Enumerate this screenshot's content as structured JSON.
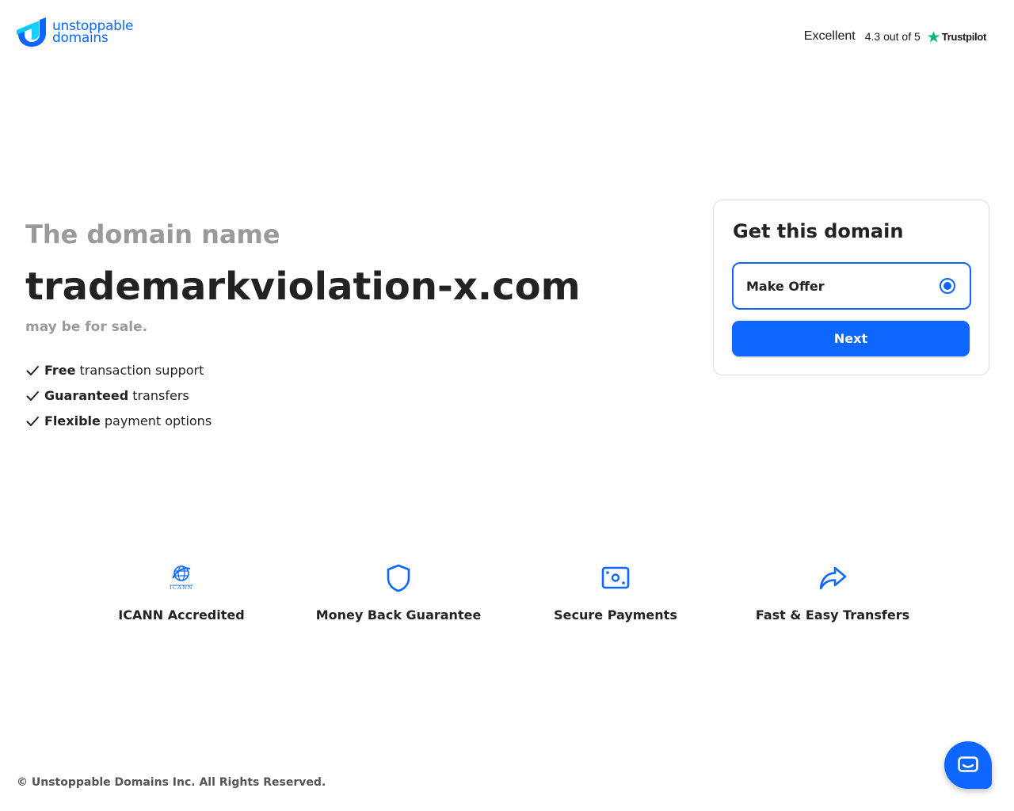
{
  "brand": {
    "logo_line1": "unstoppable",
    "logo_line2": "domains",
    "accent_color": "#0d67fe",
    "logo_icon": "unstoppable-u-logo-icon"
  },
  "trustpilot": {
    "rating_word": "Excellent",
    "score_text": "4.3 out of 5",
    "brand": "Trustpilot",
    "star_color": "#00b67a"
  },
  "hero": {
    "kicker": "The domain name",
    "domain": "trademarkviolation-x.com",
    "subtitle": "may be for sale.",
    "features": [
      {
        "bold": "Free",
        "rest": "transaction support"
      },
      {
        "bold": "Guaranteed",
        "rest": "transfers"
      },
      {
        "bold": "Flexible",
        "rest": "payment options"
      }
    ]
  },
  "card": {
    "title": "Get this domain",
    "option_label": "Make Offer",
    "option_selected": true,
    "next_label": "Next"
  },
  "badges": [
    {
      "label": "ICANN Accredited",
      "icon": "icann-globe-icon",
      "icon_caption": "ICANN"
    },
    {
      "label": "Money Back Guarantee",
      "icon": "shield-icon"
    },
    {
      "label": "Secure Payments",
      "icon": "money-bill-icon"
    },
    {
      "label": "Fast & Easy Transfers",
      "icon": "share-arrow-icon"
    }
  ],
  "footer": {
    "copyright": "© Unstoppable Domains Inc. All Rights Reserved."
  },
  "chat": {
    "icon": "chat-bubble-icon"
  }
}
